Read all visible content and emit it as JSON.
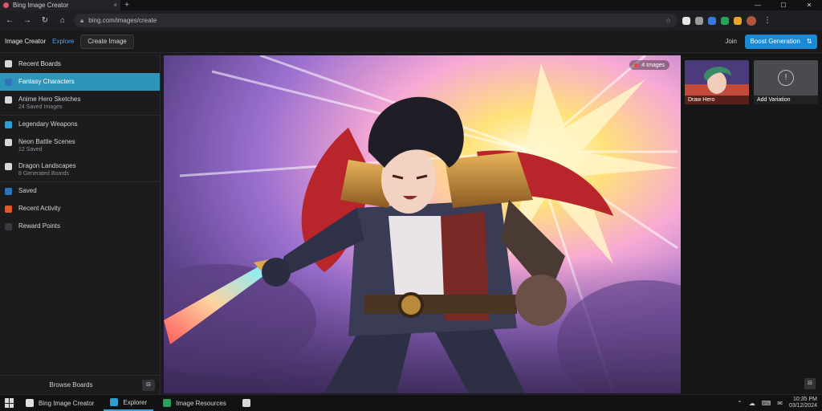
{
  "browser": {
    "tab_title": "Bing Image Creator",
    "tab_close": "×",
    "new_tab": "+",
    "address": "bing.com/images/create",
    "window_controls": [
      "—",
      "☐",
      "✕"
    ],
    "nav": {
      "back": "←",
      "forward": "→",
      "reload": "↻",
      "home": "⌂"
    },
    "star": "☆",
    "extension_colors": [
      "#e6e6e6",
      "#9a9a9a",
      "#3a78e0",
      "#27a35c",
      "#e7a62a"
    ]
  },
  "app": {
    "title": "Image Creator",
    "link": "Explore",
    "header_button": "Create Image",
    "header_text": "Join",
    "primary_button": "Boost Generation",
    "primary_button_icon": "⇅"
  },
  "sidebar": {
    "heading": "Recent Boards",
    "items": [
      {
        "label": "Fantasy Characters",
        "sub": "",
        "icon_color": "#2f73b8",
        "active": true
      },
      {
        "label": "Anime Hero Sketches",
        "sub": "24 Saved Images",
        "icon_color": "#d8d8d8",
        "active": false
      },
      {
        "label": "Legendary Weapons",
        "sub": "",
        "icon_color": "#2f9fd0",
        "active": false
      },
      {
        "label": "Neon Battle Scenes",
        "sub": "12 Saved",
        "icon_color": "#d8d8d8",
        "active": false
      },
      {
        "label": "Dragon Landscapes",
        "sub": "8 Generated Boards",
        "icon_color": "#d8d8d8",
        "active": false
      },
      {
        "label": "Saved",
        "sub": "",
        "icon_color": "#2f73b8",
        "active": false
      },
      {
        "label": "Recent Activity",
        "sub": "",
        "icon_color": "#e0582c",
        "active": false
      },
      {
        "label": "Reward Points",
        "sub": "",
        "icon_color": "#3a3a3e",
        "active": false
      }
    ],
    "footer_label": "Browse Boards",
    "footer_button": "⊟"
  },
  "viewer": {
    "badge": "4 Images"
  },
  "right_panel": {
    "thumbs": [
      {
        "label": "Draw Hero",
        "kind": "image"
      },
      {
        "label": "Add Variation",
        "kind": "avatar",
        "avatar_glyph": "!"
      }
    ],
    "button": "⊟"
  },
  "taskbar": {
    "tasks": [
      {
        "label": "Bing Image Creator",
        "icon_color": "#e0e0e0",
        "active": false
      },
      {
        "label": "Explorer",
        "icon_color": "#2f9fd0",
        "active": true
      },
      {
        "label": "Image Resources",
        "icon_color": "#27a35c",
        "active": false
      },
      {
        "label": "",
        "icon_color": "#d8d8d8",
        "active": false
      }
    ],
    "tray_icons": [
      "⌃",
      "☁",
      "⌨",
      "✉"
    ],
    "time": "10:35 PM",
    "date": "03/12/2024"
  }
}
